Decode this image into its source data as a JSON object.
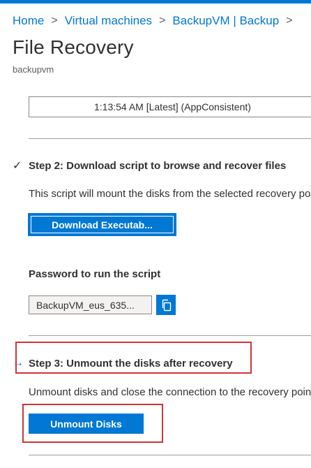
{
  "breadcrumb": [
    {
      "label": "Home"
    },
    {
      "label": "Virtual machines"
    },
    {
      "label": "BackupVM | Backup"
    }
  ],
  "breadcrumb_separator": ">",
  "page": {
    "title": "File Recovery",
    "subtitle": "backupvm"
  },
  "recovery_point": {
    "value": "1:13:54 AM [Latest] (AppConsistent)"
  },
  "step2": {
    "status_mark": "✓",
    "title": "Step 2: Download script to browse and recover files",
    "description": "This script will mount the disks from the selected recovery point",
    "download_button": "Download Executab...",
    "password_label": "Password to run the script",
    "password_value": "BackupVM_eus_635...",
    "copy_icon": "copy-icon"
  },
  "step3": {
    "status_mark": "→",
    "title": "Step 3: Unmount the disks after recovery",
    "description": "Unmount disks and close the connection to the recovery point",
    "unmount_button": "Unmount Disks"
  },
  "colors": {
    "accent": "#0078d4",
    "highlight": "#d13438",
    "text": "#323130"
  }
}
